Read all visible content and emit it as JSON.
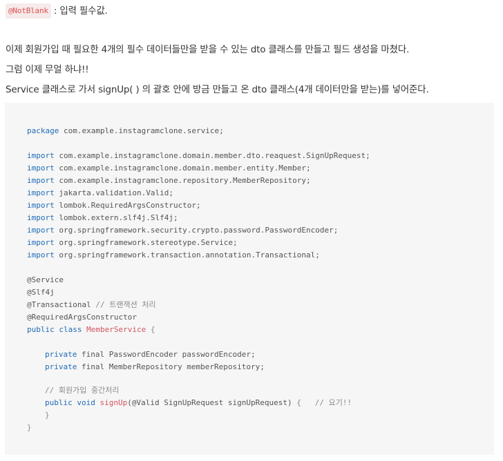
{
  "note": {
    "badge": "@NotBlank",
    "text": ": 입력 필수값."
  },
  "paragraphs": [
    "이제 회원가입 때 필요한 4개의 필수 데이터들만을 받을 수 있는 dto 클래스를 만들고 필드 생성을 마쳤다.",
    "그럼 이제 무얼 하냐!!",
    "Service 클래스로 가서 signUp( ) 의 괄호 안에 방금 만들고 온 dto 클래스(4개 데이터만을 받는)를 넣어준다."
  ],
  "code": {
    "package_kw": "package",
    "package_name": "com.example.instagramclone.service;",
    "import_kw": "import",
    "imports": [
      "com.example.instagramclone.domain.member.dto.reaquest.SignUpRequest;",
      "com.example.instagramclone.domain.member.entity.Member;",
      "com.example.instagramclone.repository.MemberRepository;",
      "jakarta.validation.Valid;",
      "lombok.RequiredArgsConstructor;",
      "lombok.extern.slf4j.Slf4j;",
      "org.springframework.security.crypto.password.PasswordEncoder;",
      "org.springframework.stereotype.Service;",
      "org.springframework.transaction.annotation.Transactional;"
    ],
    "ann_service": "@Service",
    "ann_slf4j": "@Slf4j",
    "ann_transactional": "@Transactional",
    "comment_transaction": "// 트랜잭션 처리",
    "ann_rac": "@RequiredArgsConstructor",
    "class_mods": "public class",
    "class_name": "MemberService",
    "open_brace": "{",
    "private_kw": "private",
    "field1": "final PasswordEncoder passwordEncoder;",
    "field2": "final MemberRepository memberRepository;",
    "comment_signup": "// 회원가입 중간처리",
    "method_mods": "public void",
    "method_name": "signUp",
    "method_params": "(@Valid SignUpRequest signUpRequest)",
    "method_open": " {",
    "comment_yogi": "// 요기!!",
    "method_close": "}",
    "class_close": "}"
  }
}
